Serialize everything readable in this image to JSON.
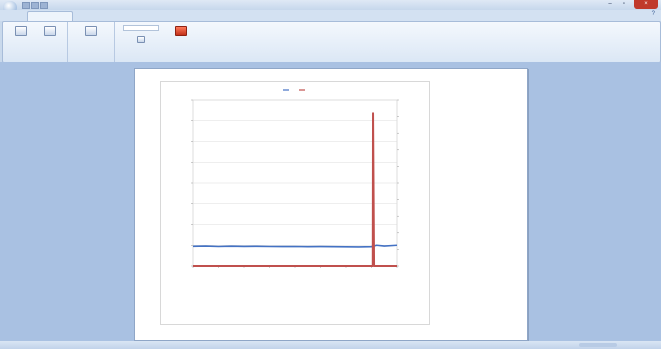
{
  "window": {
    "title": ""
  },
  "ribbon": {
    "tab_label": "",
    "groups": [
      {
        "label": "",
        "buttons": [
          "",
          ""
        ]
      },
      {
        "label": "",
        "buttons": [
          ""
        ]
      },
      {
        "label": "",
        "buttons": [
          "",
          ""
        ]
      }
    ]
  },
  "status": {
    "left_text": "",
    "zoom": ""
  },
  "chart_data": {
    "type": "line",
    "title": "",
    "legend_position": "top",
    "left_axis": {
      "label": "",
      "ticks": []
    },
    "right_axis": {
      "label": "",
      "ticks": []
    },
    "x_tick_labels": [
      "",
      "",
      "",
      "",
      "",
      "",
      "",
      "",
      ""
    ],
    "series": [
      {
        "color": "#4472c4",
        "axis": "left",
        "points": [
          [
            0,
            950
          ],
          [
            0.5,
            960
          ],
          [
            1,
            940
          ],
          [
            1.5,
            955
          ],
          [
            2,
            945
          ],
          [
            2.5,
            950
          ],
          [
            3,
            940
          ],
          [
            3.5,
            935
          ],
          [
            4,
            940
          ],
          [
            4.5,
            930
          ],
          [
            5,
            935
          ],
          [
            5.5,
            930
          ],
          [
            6,
            925
          ],
          [
            6.5,
            920
          ],
          [
            7,
            930
          ],
          [
            7.2,
            1000
          ],
          [
            7.5,
            960
          ],
          [
            8,
            1000
          ]
        ]
      },
      {
        "color": "#c0504d",
        "axis": "right",
        "points": [
          [
            0,
            0
          ],
          [
            7.05,
            0
          ],
          [
            7.06,
            0.92
          ],
          [
            7.1,
            0
          ],
          [
            8,
            0
          ]
        ]
      }
    ]
  },
  "colors": {
    "ribbon_accent": "#d3e1f2",
    "workspace": "#a9c1e2",
    "close": "#c0392b"
  },
  "icons": [
    "app-orb-icon",
    "save-icon",
    "undo-icon",
    "print-icon",
    "page-setup-icon",
    "zoom-icon",
    "close-preview-icon"
  ]
}
